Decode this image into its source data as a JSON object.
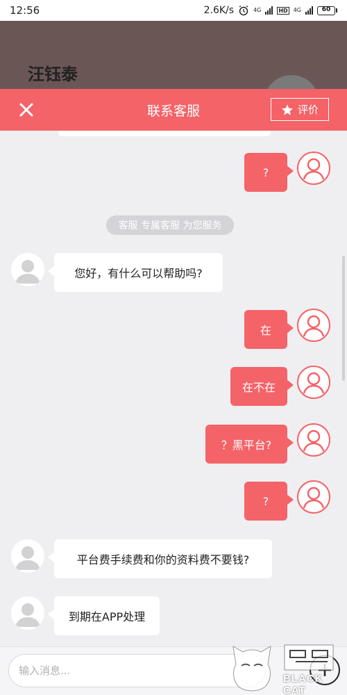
{
  "status_bar": {
    "time": "12:56",
    "net_speed": "2.6K/s",
    "net_type_1": "4G",
    "hd": "HD",
    "net_type_2": "4G",
    "battery": "60"
  },
  "background_header": {
    "name": "汪钰泰"
  },
  "navbar": {
    "title": "联系客服",
    "rate_label": "评价"
  },
  "chat": {
    "system_notice": "客服 专属客服 为您服务",
    "messages": [
      {
        "from": "me",
        "text": "?"
      },
      {
        "from": "cs",
        "text": "您好，有什么可以帮助吗?"
      },
      {
        "from": "me",
        "text": "在"
      },
      {
        "from": "me",
        "text": "在不在"
      },
      {
        "from": "me",
        "text": "？黑平台?"
      },
      {
        "from": "me",
        "text": "?"
      },
      {
        "from": "cs",
        "text": "平台费手续费和你的资料费不要钱?"
      },
      {
        "from": "cs",
        "text": "到期在APP处理"
      }
    ]
  },
  "input": {
    "placeholder": "输入消息..."
  },
  "watermark": {
    "text": "BLACK CAT"
  },
  "colors": {
    "accent": "#f46368",
    "background": "#efeff2"
  }
}
